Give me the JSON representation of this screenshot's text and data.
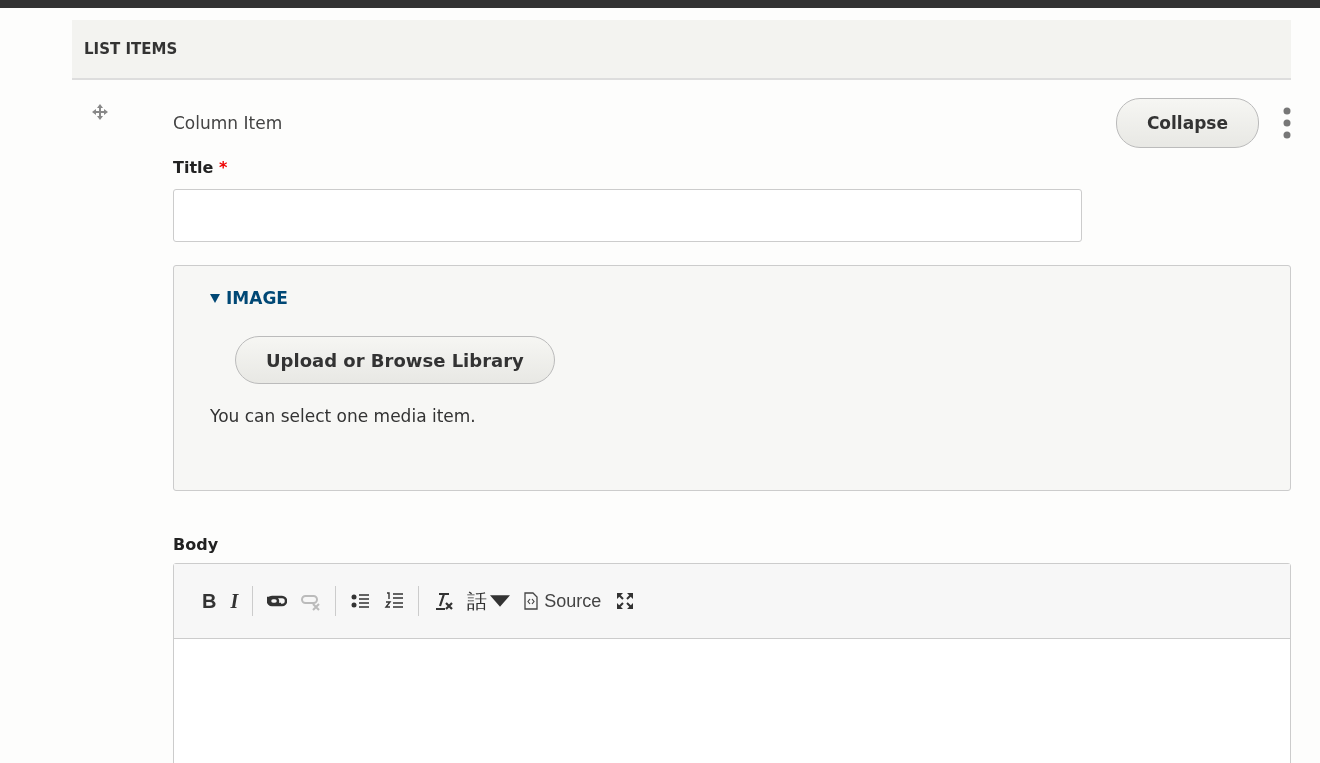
{
  "section": {
    "title": "LIST ITEMS"
  },
  "item": {
    "label": "Column Item",
    "collapse_button": "Collapse",
    "title_field": {
      "label": "Title",
      "required_mark": "*"
    },
    "image": {
      "legend": "IMAGE",
      "expanded": true,
      "button": "Upload or Browse Library",
      "help": "You can select one media item."
    },
    "body": {
      "label": "Body",
      "toolbar": [
        {
          "kind": "bold",
          "label": "B",
          "disabled": false
        },
        {
          "kind": "italic",
          "label": "I",
          "disabled": false
        },
        {
          "kind": "separator"
        },
        {
          "kind": "link",
          "disabled": false
        },
        {
          "kind": "unlink",
          "disabled": true
        },
        {
          "kind": "separator"
        },
        {
          "kind": "bullets",
          "disabled": false
        },
        {
          "kind": "numbering",
          "disabled": false
        },
        {
          "kind": "separator"
        },
        {
          "kind": "clearformat",
          "disabled": false
        },
        {
          "kind": "dropdown",
          "label": "話",
          "disabled": false
        },
        {
          "kind": "source",
          "label": "Source",
          "disabled": false
        },
        {
          "kind": "maximize",
          "disabled": false
        }
      ]
    }
  }
}
